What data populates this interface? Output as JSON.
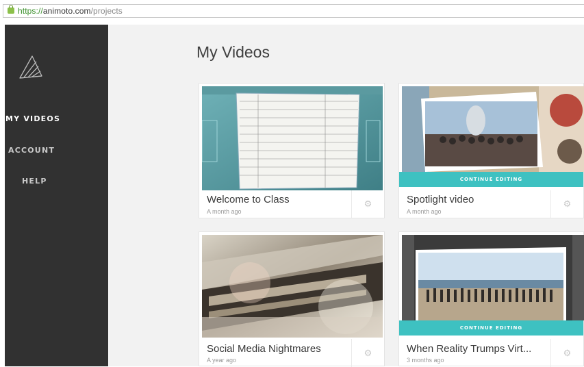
{
  "browser": {
    "url_scheme": "https://",
    "url_host": "animoto.com",
    "url_path": "/projects"
  },
  "sidebar": {
    "items": [
      {
        "label": "MY VIDEOS"
      },
      {
        "label": "ACCOUNT"
      },
      {
        "label": "HELP"
      }
    ]
  },
  "main": {
    "title": "My Videos",
    "videos": [
      {
        "title": "Welcome to Class",
        "date": "A month ago"
      },
      {
        "title": "Spotlight video",
        "date": "A month ago",
        "action": "CONTINUE EDITING"
      },
      {
        "title": "Social Media Nightmares",
        "date": "A year ago"
      },
      {
        "title": "When Reality Trumps Virt...",
        "date": "3 months ago",
        "action": "CONTINUE EDITING"
      }
    ]
  },
  "colors": {
    "sidebar_bg": "#313131",
    "main_bg": "#f2f2f2",
    "accent": "#3ec1c1"
  },
  "icons": {
    "lock": "lock-icon",
    "logo": "animoto-logo-icon",
    "settings": "gear-icon"
  }
}
